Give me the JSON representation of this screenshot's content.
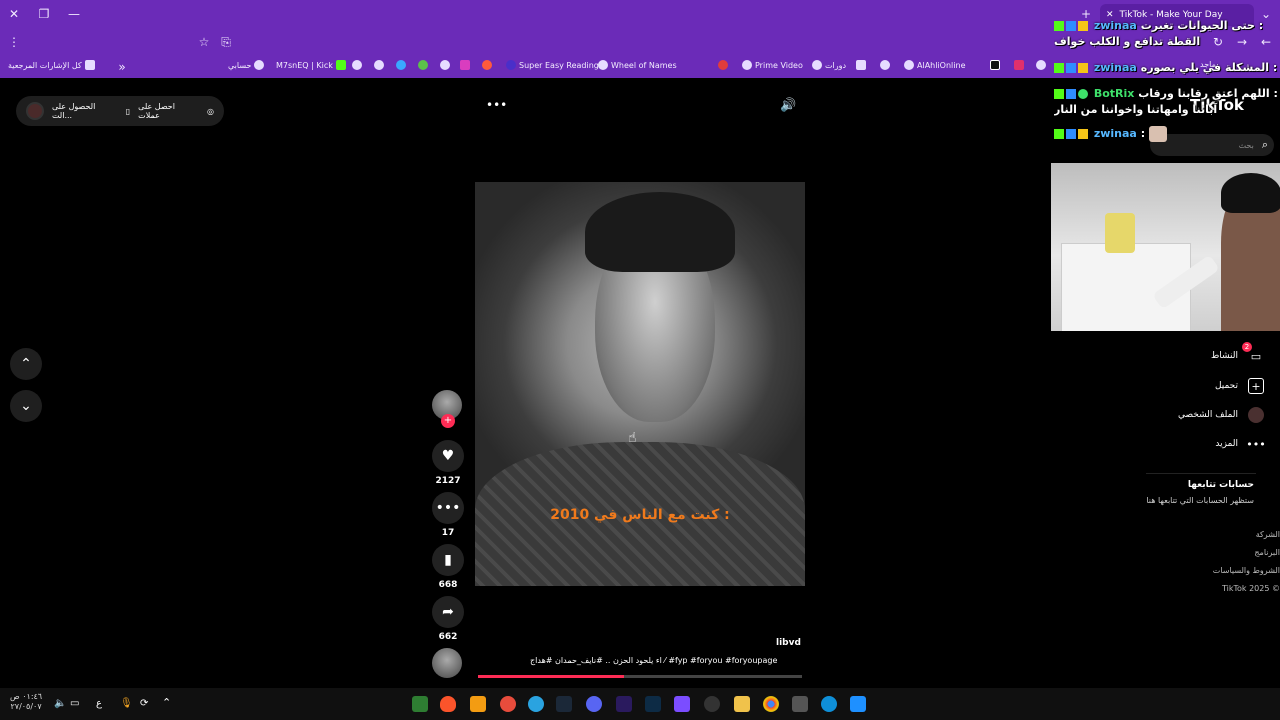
{
  "browser": {
    "tab_title": "TikTok - Make Your Day",
    "new_tab": "+",
    "bookmarks": [
      "حسابي",
      "M7snEQ | Kick",
      "Super Easy Reading",
      "Wheel of Names",
      "Prime Video",
      "دورات",
      "AlAhliOnline",
      "ماجد"
    ],
    "all_bookmarks": "كل الإشارات المرجعية"
  },
  "page": {
    "pill_left": "الحصول على الت...",
    "pill_right": "احصل على عملات",
    "more": "•••",
    "sound": "🔊",
    "nav_up": "⌃",
    "nav_down": "⌄"
  },
  "video": {
    "caption": "كنت مع الناس في 2010 :",
    "progress": 0.45
  },
  "actions": {
    "likes": "2127",
    "comments": "17",
    "saves": "668",
    "shares": "662"
  },
  "post": {
    "author": "libvd",
    "description": "اء يلحود الحزن .. #نايف_حمدان #هداج ⁄ #fyp #foryou #foryoupage"
  },
  "sidebar": {
    "search_placeholder": "بحث",
    "logo": "TikTok",
    "items": [
      "النشاط",
      "تحميل",
      "الملف الشخصي",
      "المزيد"
    ],
    "following_title": "حسابات تتابعها",
    "following_sub": "ستظهر الحسابات التي تتابعها هنا",
    "footer": [
      "الشركة",
      "البرنامج",
      "الشروط والسياسات",
      "TikTok 2025 ©"
    ],
    "activity_badge": "2"
  },
  "chat": [
    {
      "user": "zwinaa",
      "text": "حتى الحيوانات تغيرت :"
    },
    {
      "user": "",
      "text": "القطة تدافع و الكلب خواف"
    },
    {
      "user": "zwinaa",
      "text": "المشكلة في يلي بصوره :"
    },
    {
      "user": "BotRix",
      "text": "اللهم اعتق رقابنا ورقاب :"
    },
    {
      "user": "",
      "text": "آبائنا وامهاتنا واخواننا من النار"
    },
    {
      "user": "zwinaa",
      "text": ":"
    }
  ],
  "taskbar": {
    "time": "٠١:٤٦ ص",
    "date": "٢٧/٠٥/٠٧",
    "lang": "ع"
  },
  "colors": {
    "browser": "#6b2bb8",
    "accent": "#fe2c55",
    "caption": "#f07a1c"
  }
}
